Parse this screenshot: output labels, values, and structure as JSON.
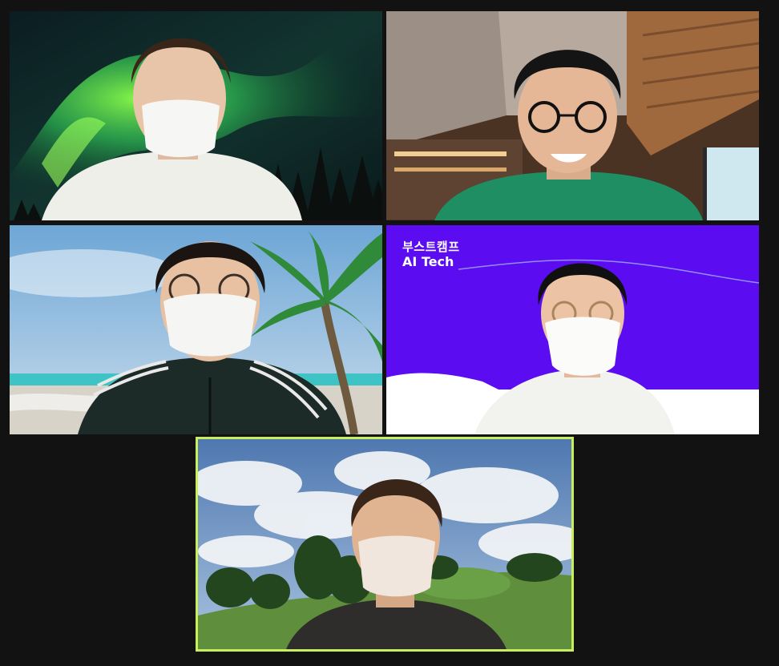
{
  "meeting": {
    "participants": [
      {
        "background": "aurora-night-sky"
      },
      {
        "background": "wooden-cafe-interior"
      },
      {
        "background": "tropical-beach-palm"
      },
      {
        "background": "boostcamp-ai-tech-purple",
        "overlay_text": [
          "부스트캠프",
          "AI Tech"
        ]
      },
      {
        "background": "park-hill-cloudy-sky",
        "active_speaker": true
      }
    ]
  },
  "colors": {
    "window_bg": "#121212",
    "active_speaker_border": "#c8ee5a",
    "boostcamp_purple": "#5b0cf0"
  }
}
